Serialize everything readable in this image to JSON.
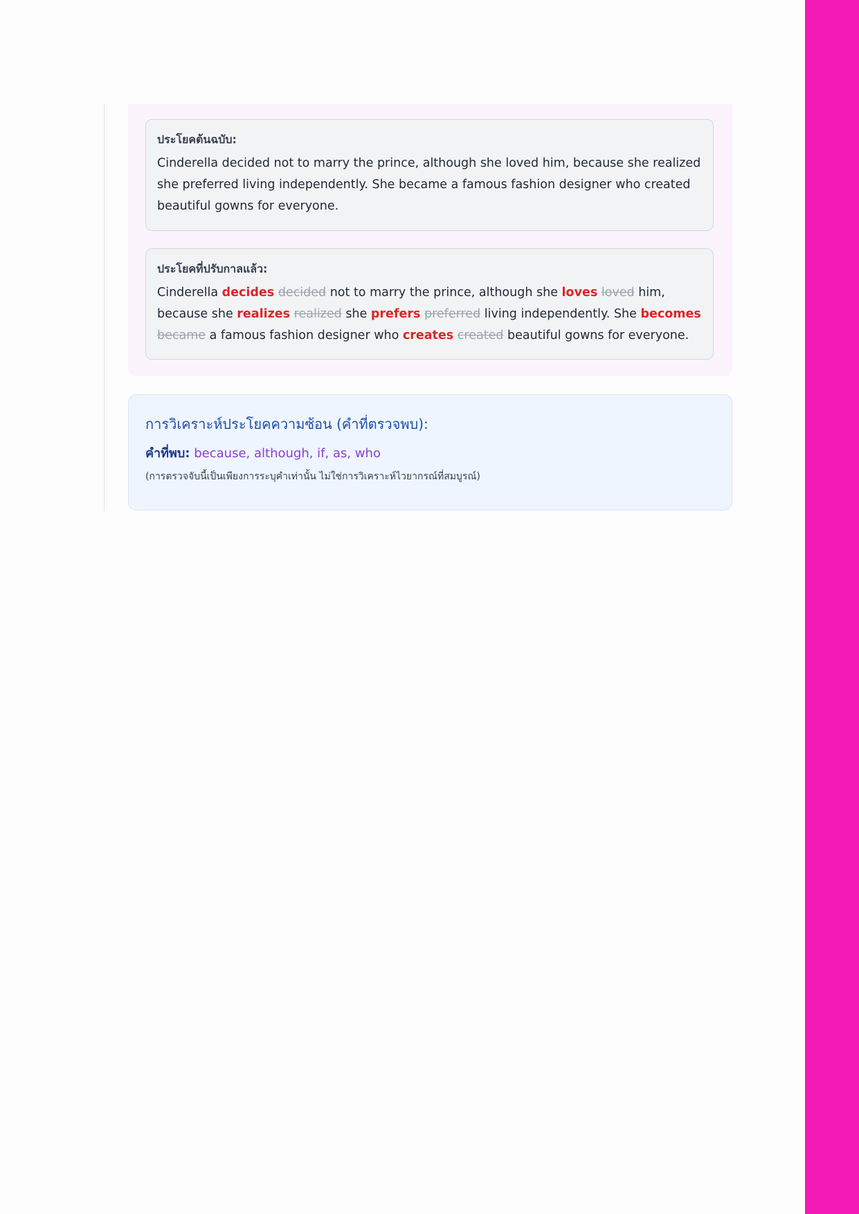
{
  "colors": {
    "accent_bar": "#f31ab8",
    "new_verb": "#dc2626",
    "old_verb": "#9ca3af",
    "analysis_title": "#1e4fa8",
    "found_words": "#8a3fd1"
  },
  "original": {
    "label": "ประโยคต้นฉบับ:",
    "text": "Cinderella decided not to marry the prince, although she loved him, because she realized she preferred living independently. She became a famous fashion designer who created beautiful gowns for everyone."
  },
  "adjusted": {
    "label": "ประโยคที่ปรับกาลแล้ว:",
    "segments": [
      "Cinderella ",
      "decides",
      "decided",
      " not to marry the prince, although she ",
      "loves",
      "loved",
      " him, because she ",
      "realizes",
      "realized",
      " she ",
      "prefers",
      "preferred",
      " living independently. She ",
      "becomes",
      "became",
      " a famous fashion designer who ",
      "creates",
      "created",
      " beautiful gowns for everyone."
    ]
  },
  "analysis": {
    "title": "การวิเคราะห์ประโยคความซ้อน (คำที่ตรวจพบ):",
    "found_label": "คำที่พบ:",
    "found_words": "because, although, if, as, who",
    "note": "(การตรวจจับนี้เป็นเพียงการระบุคำเท่านั้น ไม่ใช่การวิเคราะห์ไวยากรณ์ที่สมบูรณ์)"
  }
}
